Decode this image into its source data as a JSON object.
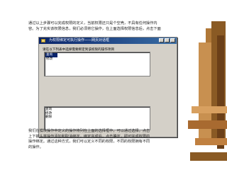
{
  "paragraph_top": [
    "通过以上步骤可以完成权限的定义，当前权限还只是个空壳，不具有任何操作内",
    "容。为了充实该权限信息，我们必须将它操作，在上面选择权限信息后，点击下面"
  ],
  "paragraph_bottom": [
    "我们在模块操作中定义的操作将列在上面的选择框中，可以通过选择，点击",
    "上下箭头将操作添加和取消绑定，绑定完成后，点击确定，即可完成权限的",
    "操作绑定。通过这种方式，我们可以定义不同的权限，不同的权限拥有不同",
    "的操作。"
  ],
  "window": {
    "title": "为权限绑定可执行操作——网页对话框",
    "description": "请在以下列表中选择需要绑定到该权限的操作项目",
    "available_list": [
      "查询",
      "修改"
    ],
    "selected_index": 0,
    "bound_list": [
      "查询",
      "修改",
      "删除"
    ]
  }
}
